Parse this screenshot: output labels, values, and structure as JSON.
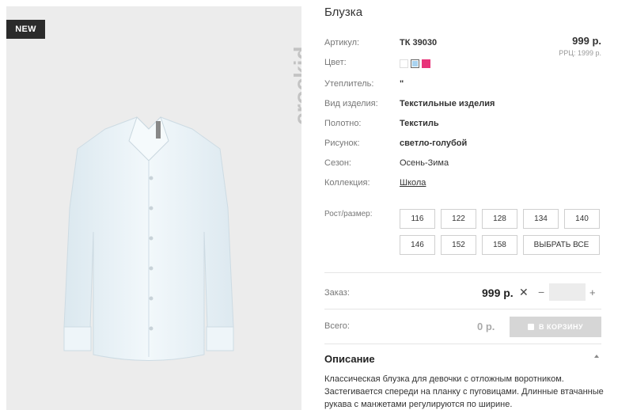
{
  "badge": "NEW",
  "logo_text": "crockid",
  "product": {
    "title": "Блузка",
    "price": "999 р.",
    "rrp": "РРЦ: 1999 р."
  },
  "attributes": [
    {
      "label": "Артикул:",
      "value": "ТК 39030"
    },
    {
      "label": "Цвет:",
      "value": ""
    },
    {
      "label": "Утеплитель:",
      "value": "\""
    },
    {
      "label": "Вид изделия:",
      "value": "Текстильные изделия"
    },
    {
      "label": "Полотно:",
      "value": "Текстиль"
    },
    {
      "label": "Рисунок:",
      "value": "светло-голубой"
    },
    {
      "label": "Сезон:",
      "value": "Осень-Зима"
    },
    {
      "label": "Коллекция:",
      "value": "Школа"
    }
  ],
  "colors": [
    "#ffffff",
    "#a9d3f0",
    "#e8347a"
  ],
  "sizes": {
    "label": "Рост/размер:",
    "options": [
      "116",
      "122",
      "128",
      "134",
      "140",
      "146",
      "152",
      "158"
    ],
    "select_all": "ВЫБРАТЬ ВСЕ"
  },
  "order": {
    "label": "Заказ:",
    "price": "999 р.",
    "remove": "✕",
    "minus": "−",
    "plus": "+",
    "qty": ""
  },
  "total": {
    "label": "Всего:",
    "price": "0 р.",
    "cart_button": "В КОРЗИНУ"
  },
  "description": {
    "title": "Описание",
    "text": "Классическая блузка для девочки с отложным воротником. Застегивается спереди на планку с пуговицами. Длинные втачанные рукава с манжетами регулируются по ширине."
  }
}
